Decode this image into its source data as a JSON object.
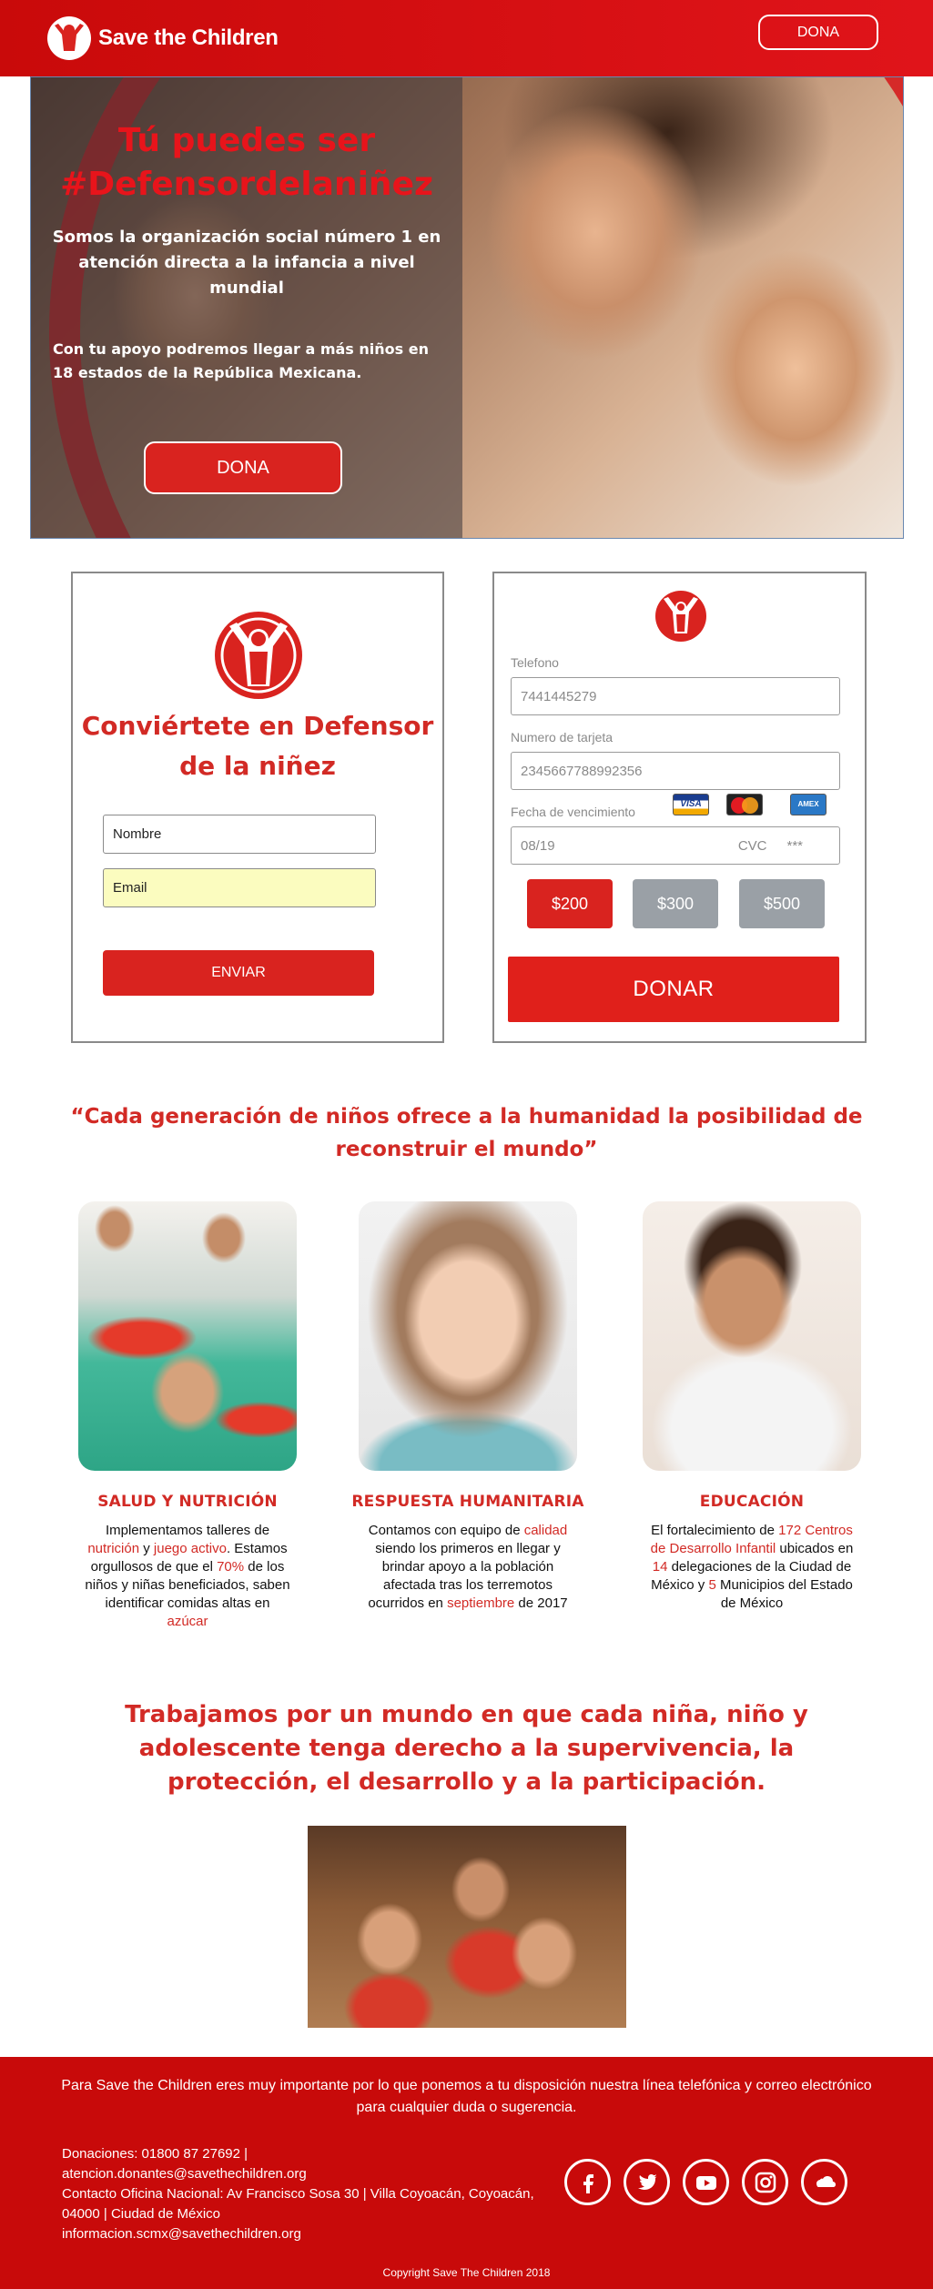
{
  "header": {
    "logo_text": "Save the Children",
    "dona_label": "DONA"
  },
  "hero": {
    "title_line1": "Tú puedes ser",
    "title_line2": "#Defensordelaniñez",
    "subtitle": "Somos la organización social número 1 en atención directa a la infancia a nivel mundial",
    "body": "Con tu apoyo podremos llegar a más niños en 18 estados de la República Mexicana.",
    "dona_label": "DONA"
  },
  "signup": {
    "title": "Conviértete en Defensor de la niñez",
    "nombre_placeholder": "Nombre",
    "email_placeholder": "Email",
    "submit_label": "ENVIAR"
  },
  "payment": {
    "phone_label": "Telefono",
    "phone_value": "7441445279",
    "card_label": "Numero de tarjeta",
    "card_value": "2345667788992356",
    "expiry_label": "Fecha de vencimiento",
    "expiry_value": "08/19",
    "cvc_label": "CVC",
    "cvc_value": "***",
    "card_brands": [
      "VISA",
      "MasterCard",
      "AMERICAN EXPRESS"
    ],
    "amounts": [
      "$200",
      "$300",
      "$500"
    ],
    "selected_amount": "$200",
    "submit_label": "DONAR"
  },
  "quote": "“Cada generación de niños ofrece a la humanidad la posibilidad de reconstruir el mundo”",
  "columns": [
    {
      "heading": "SALUD Y NUTRICIÓN",
      "t1": "Implementamos talleres de ",
      "h1": "nutrición",
      "t2": " y ",
      "h2": "juego activo",
      "t3": ". Estamos orgullosos de que el ",
      "h3": "70%",
      "t4": " de los niños y niñas beneficiados, saben identificar comidas altas en ",
      "h4": "azúcar"
    },
    {
      "heading": "RESPUESTA HUMANITARIA",
      "t1": "Contamos con equipo de ",
      "h1": "calidad",
      "t2": " siendo los primeros en llegar y brindar apoyo a la población afectada tras los terremotos ocurridos en ",
      "h2": "septiembre",
      "t3": " de 2017"
    },
    {
      "heading": "EDUCACIÓN",
      "t1": "El fortalecimiento de ",
      "h1": "172 Centros de Desarrollo Infantil",
      "t2": " ubicados en ",
      "h2": "14",
      "t3": " delegaciones de la Ciudad de México y ",
      "h3": "5",
      "t4": " Municipios del Estado de México"
    }
  ],
  "mission": "Trabajamos por un mundo en que cada niña, niño y adolescente tenga derecho a la supervivencia, la protección, el desarrollo y a la participación.",
  "footer": {
    "intro": "Para Save the Children eres muy importante por lo que ponemos a tu disposición nuestra línea telefónica y correo electrónico para cualquier duda o sugerencia.",
    "donaciones": "Donaciones: 01800 87 27692 |",
    "email1": "atencion.donantes@savethechildren.org",
    "oficina": "Contacto Oficina Nacional: Av Francisco Sosa 30 | Villa Coyoacán, Coyoacán, 04000 | Ciudad de México",
    "email2": "informacion.scmx@savethechildren.org",
    "socials": [
      "facebook-icon",
      "twitter-icon",
      "youtube-icon",
      "instagram-icon",
      "soundcloud-icon"
    ],
    "copyright": "Copyright Save The Children 2018"
  },
  "colors": {
    "brand_red": "#d9231f",
    "header_red": "#c90a0a",
    "footer_red": "#c80a0a",
    "neutral_button": "#9aa0a6",
    "email_field_bg": "#fbfcbf"
  }
}
